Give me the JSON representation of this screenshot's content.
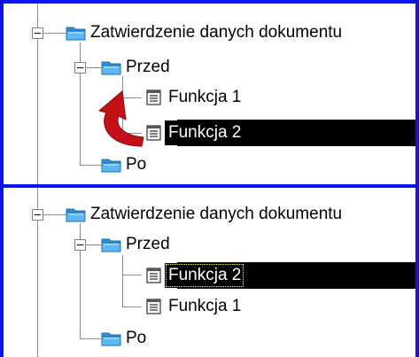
{
  "panels": [
    {
      "root": "Zatwierdzenie danych dokumentu",
      "before": "Przed",
      "functions": [
        "Funkcja 1",
        "Funkcja 2"
      ],
      "after": "Po"
    },
    {
      "root": "Zatwierdzenie danych dokumentu",
      "before": "Przed",
      "functions": [
        "Funkcja 2",
        "Funkcja 1"
      ],
      "after": "Po"
    }
  ],
  "colors": {
    "frame": "#0b14ee",
    "selection": "#000000",
    "arrow": "#c41016",
    "folder": "#3aa0e8"
  },
  "icons": [
    "folder-icon",
    "list-document-icon",
    "expand-collapse-icon",
    "curved-arrow-icon"
  ]
}
